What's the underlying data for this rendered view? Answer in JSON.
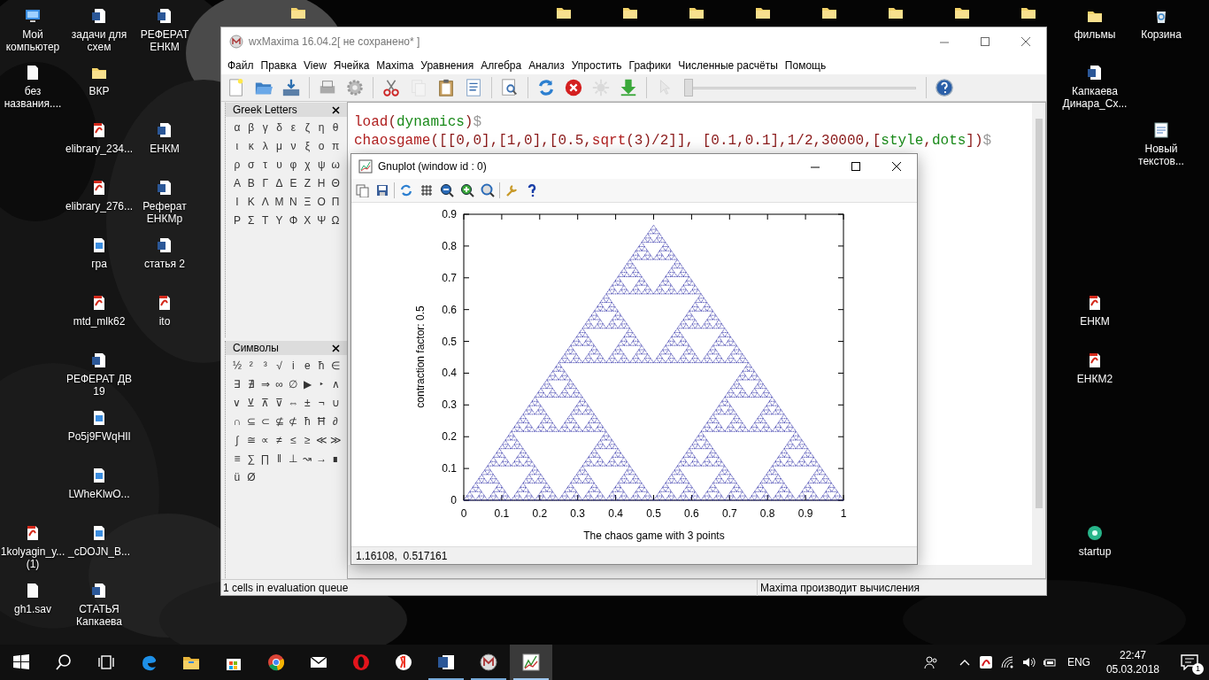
{
  "desktop_icons": [
    {
      "kind": "computer",
      "label": "Мой компьютер"
    },
    {
      "kind": "word",
      "label": "задачи для схем"
    },
    {
      "kind": "word",
      "label": "РЕФЕРАТ ЕНКМ"
    },
    {
      "kind": "file",
      "label": "без названия...."
    },
    {
      "kind": "folder",
      "label": "ВКР"
    },
    {
      "kind": "pdf",
      "label": "elibrary_234..."
    },
    {
      "kind": "word",
      "label": "ЕНКМ"
    },
    {
      "kind": "pdf",
      "label": "elibrary_276..."
    },
    {
      "kind": "word",
      "label": "Реферат ЕНКМр"
    },
    {
      "label": "гра"
    },
    {
      "kind": "word",
      "label": "статья 2"
    },
    {
      "kind": "pdf",
      "label": "mtd_mlk62"
    },
    {
      "kind": "pdf",
      "label": "ito"
    },
    {
      "kind": "word",
      "label": "РЕФЕРАТ ДВ 19"
    },
    {
      "label": "Po5j9FWqHIl"
    },
    {
      "label": "LWheKlwO..."
    },
    {
      "kind": "pdf",
      "label": "1kolyagin_y... (1)"
    },
    {
      "label": "_cDOJN_B..."
    },
    {
      "kind": "file",
      "label": "gh1.sav"
    },
    {
      "kind": "word",
      "label": "СТАТЬЯ Капкаева"
    },
    {
      "kind": "folder"
    },
    {
      "kind": "folder"
    },
    {
      "kind": "folder"
    },
    {
      "kind": "folder"
    },
    {
      "kind": "folder"
    },
    {
      "kind": "folder"
    },
    {
      "kind": "folder"
    },
    {
      "kind": "folder"
    },
    {
      "kind": "folder"
    },
    {
      "kind": "folder",
      "label": "фильмы"
    },
    {
      "kind": "recycle",
      "label": "Корзина"
    },
    {
      "kind": "word",
      "label": "Капкаева Динара_Сх..."
    },
    {
      "kind": "text",
      "label": "Новый текстов..."
    },
    {
      "kind": "pdf",
      "label": "ЕНКМ"
    },
    {
      "kind": "pdf",
      "label": "ЕНКМ2"
    },
    {
      "kind": "startup",
      "label": "startup"
    }
  ],
  "maxima": {
    "title": "wxMaxima 16.04.2[ не сохранено* ]",
    "menu": [
      "Файл",
      "Правка",
      "View",
      "Ячейка",
      "Maxima",
      "Уравнения",
      "Алгебра",
      "Анализ",
      "Упростить",
      "Графики",
      "Численные расчёты",
      "Помощь"
    ],
    "toolbar": [
      {
        "kind": "new",
        "disabled": false
      },
      {
        "kind": "open",
        "disabled": false
      },
      {
        "kind": "save",
        "disabled": false
      },
      {
        "kind": "sep"
      },
      {
        "kind": "print",
        "disabled": false
      },
      {
        "kind": "settings",
        "disabled": false
      },
      {
        "kind": "sep"
      },
      {
        "kind": "cut",
        "disabled": false
      },
      {
        "kind": "copy",
        "disabled": true
      },
      {
        "kind": "paste",
        "disabled": false
      },
      {
        "kind": "select",
        "disabled": false
      },
      {
        "kind": "sep"
      },
      {
        "kind": "find",
        "disabled": false
      },
      {
        "kind": "sep"
      },
      {
        "kind": "refresh",
        "disabled": false
      },
      {
        "kind": "stop",
        "disabled": false
      },
      {
        "kind": "interrupt",
        "disabled": true
      },
      {
        "kind": "download",
        "disabled": false
      },
      {
        "kind": "sep"
      },
      {
        "kind": "pointer",
        "disabled": true
      },
      {
        "kind": "slider",
        "level": 0
      },
      {
        "kind": "sep"
      },
      {
        "kind": "help",
        "disabled": false
      }
    ],
    "greek_panel": {
      "title": "Greek Letters",
      "symbols": [
        "α",
        "β",
        "γ",
        "δ",
        "ε",
        "ζ",
        "η",
        "θ",
        "ι",
        "κ",
        "λ",
        "μ",
        "ν",
        "ξ",
        "ο",
        "π",
        "ρ",
        "σ",
        "τ",
        "υ",
        "φ",
        "χ",
        "ψ",
        "ω",
        "Α",
        "Β",
        "Γ",
        "Δ",
        "Ε",
        "Ζ",
        "Η",
        "Θ",
        "Ι",
        "Κ",
        "Λ",
        "Μ",
        "Ν",
        "Ξ",
        "Ο",
        "Π",
        "Ρ",
        "Σ",
        "Τ",
        "Υ",
        "Φ",
        "Χ",
        "Ψ",
        "Ω"
      ]
    },
    "symbols_panel": {
      "title": "Символы",
      "symbols": [
        "½",
        "²",
        "³",
        "√",
        "i",
        "e",
        "ħ",
        "∈",
        "∃",
        "∄",
        "⇒",
        "∞",
        "∅",
        "▶",
        "‣",
        "∧",
        "∨",
        "⊻",
        "⊼",
        "⊽",
        "⇔",
        "±",
        "¬",
        "∪",
        "∩",
        "⊆",
        "⊂",
        "⊈",
        "⊄",
        "ħ",
        "Ħ",
        "∂",
        "∫",
        "≅",
        "∝",
        "≠",
        "≤",
        "≥",
        "≪",
        "≫",
        "≡",
        "∑",
        "∏",
        "‖",
        "⊥",
        "↝",
        "→",
        "∎",
        "ü",
        "Ø"
      ]
    },
    "code_lines": [
      [
        {
          "text": "load",
          "kind": "function"
        },
        {
          "text": "(",
          "kind": "code"
        },
        {
          "text": "dynamics",
          "kind": "variable"
        },
        {
          "text": ")",
          "kind": "code"
        },
        {
          "text": "$",
          "kind": "end"
        }
      ],
      [
        {
          "text": "chaosgame",
          "kind": "function"
        },
        {
          "text": "([[0,0],[1,0],[0.5,",
          "kind": "code"
        },
        {
          "text": "sqrt",
          "kind": "function"
        },
        {
          "text": "(3)/2]], [0.1,0.1],1/2,30000,[",
          "kind": "code"
        },
        {
          "text": "style",
          "kind": "variable"
        },
        {
          "text": ",",
          "kind": "code"
        },
        {
          "text": "dots",
          "kind": "variable"
        },
        {
          "text": "])",
          "kind": "code"
        },
        {
          "text": "$",
          "kind": "end"
        }
      ]
    ],
    "status_left": "1 cells in evaluation queue",
    "status_right": "Maxima производит вычисления"
  },
  "gnuplot": {
    "title": "Gnuplot (window id : 0)",
    "toolbar": [
      {
        "kind": "copy"
      },
      {
        "kind": "print"
      },
      {
        "kind": "replot"
      },
      {
        "kind": "grid"
      },
      {
        "kind": "zoom-previous"
      },
      {
        "kind": "zoom-next"
      },
      {
        "kind": "zoom-autoscale"
      },
      {
        "kind": "wrench"
      },
      {
        "kind": "help"
      }
    ],
    "plot": {
      "ylabel": "contraction factor: 0.5",
      "xlabel": "The chaos game with 3 points",
      "xticks": [
        "0",
        "0.1",
        "0.2",
        "0.3",
        "0.4",
        "0.5",
        "0.6",
        "0.7",
        "0.8",
        "0.9",
        "1"
      ],
      "yticks": [
        "0.9",
        "0.8",
        "0.7",
        "0.6",
        "0.5",
        "0.4",
        "0.3",
        "0.2",
        "0.1",
        "0"
      ]
    },
    "status": "1.16108,  0.517161"
  },
  "taskbar": {
    "apps": [
      {
        "kind": "edge",
        "running": false,
        "selected": false
      },
      {
        "kind": "explorer",
        "running": false,
        "selected": false
      },
      {
        "kind": "store",
        "running": false,
        "selected": false
      },
      {
        "kind": "chrome",
        "running": false,
        "selected": false
      },
      {
        "kind": "mail",
        "running": false,
        "selected": false
      },
      {
        "kind": "opera",
        "running": false,
        "selected": false
      },
      {
        "kind": "yandex",
        "running": false,
        "selected": false
      },
      {
        "kind": "word",
        "running": true,
        "selected": false
      },
      {
        "kind": "maxima",
        "running": true,
        "selected": false
      },
      {
        "kind": "gnuplot",
        "running": true,
        "selected": true
      }
    ],
    "language": "ENG",
    "time": "22:47",
    "date": "05.03.2018",
    "notifications": "1"
  }
}
